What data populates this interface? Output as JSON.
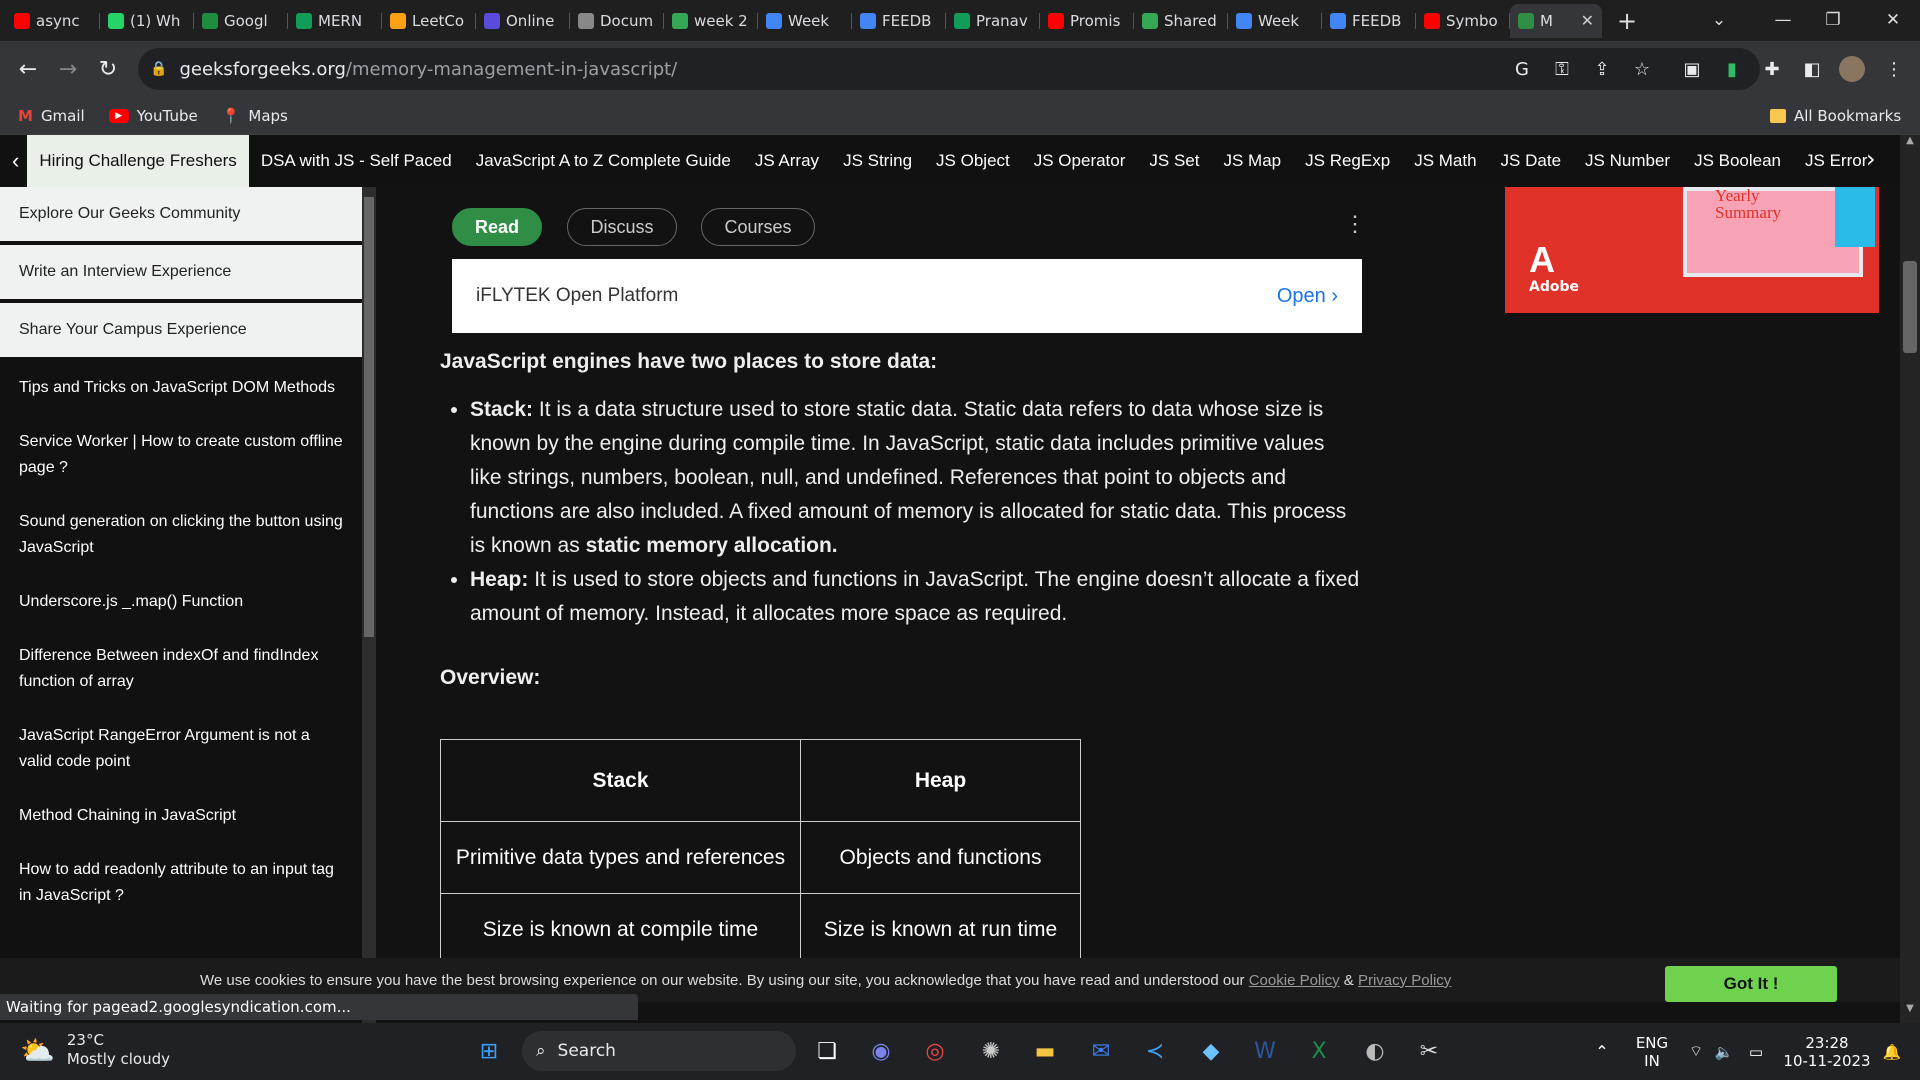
{
  "tabs": [
    {
      "title": "async",
      "icon": "youtube-icon",
      "color": "#ff0000"
    },
    {
      "title": "(1) Wh",
      "icon": "whatsapp-icon",
      "color": "#25d366"
    },
    {
      "title": "Googl",
      "icon": "google-classroom-icon",
      "color": "#1e8e3e"
    },
    {
      "title": "MERN",
      "icon": "sheets-plus-icon",
      "color": "#0f9d58"
    },
    {
      "title": "LeetCo",
      "icon": "leetcode-icon",
      "color": "#ffa116"
    },
    {
      "title": "Online",
      "icon": "online-icon",
      "color": "#5b4bdb"
    },
    {
      "title": "Docum",
      "icon": "document-icon",
      "color": "#888888"
    },
    {
      "title": "week 2",
      "icon": "drive-icon",
      "color": "#34a853"
    },
    {
      "title": "Week",
      "icon": "docs-icon",
      "color": "#4285f4"
    },
    {
      "title": "FEEDB",
      "icon": "docs-icon",
      "color": "#4285f4"
    },
    {
      "title": "Pranav",
      "icon": "sheets-plus-icon",
      "color": "#0f9d58"
    },
    {
      "title": "Promis",
      "icon": "youtube-icon",
      "color": "#ff0000"
    },
    {
      "title": "Shared",
      "icon": "drive-icon",
      "color": "#34a853"
    },
    {
      "title": "Week",
      "icon": "docs-icon",
      "color": "#4285f4"
    },
    {
      "title": "FEEDB",
      "icon": "docs-icon",
      "color": "#4285f4"
    },
    {
      "title": "Symbo",
      "icon": "youtube-icon",
      "color": "#ff0000"
    },
    {
      "title": "M",
      "icon": "gfg-icon",
      "color": "#2f8d46",
      "active": true
    }
  ],
  "url": {
    "host": "geeksforgeeks.org",
    "path": "/memory-management-in-javascript/"
  },
  "bookmarks": [
    {
      "label": "Gmail",
      "icon": "gmail-icon"
    },
    {
      "label": "YouTube",
      "icon": "youtube-icon"
    },
    {
      "label": "Maps",
      "icon": "maps-icon"
    }
  ],
  "all_bookmarks": "All Bookmarks",
  "topnav": [
    "Hiring Challenge Freshers",
    "DSA with JS - Self Paced",
    "JavaScript A to Z Complete Guide",
    "JS Array",
    "JS String",
    "JS Object",
    "JS Operator",
    "JS Set",
    "JS Map",
    "JS RegExp",
    "JS Math",
    "JS Date",
    "JS Number",
    "JS Boolean",
    "JS Error"
  ],
  "sidebar": [
    {
      "label": "Explore Our Geeks Community",
      "light": true
    },
    {
      "label": "Write an Interview Experience",
      "light": true
    },
    {
      "label": "Share Your Campus Experience",
      "light": true
    },
    {
      "label": "Tips and Tricks on JavaScript DOM Methods"
    },
    {
      "label": "Service Worker | How to create custom offline page ?"
    },
    {
      "label": "Sound generation on clicking the button using JavaScript"
    },
    {
      "label": "Underscore.js _.map() Function"
    },
    {
      "label": "Difference Between indexOf and findIndex function of array"
    },
    {
      "label": "JavaScript RangeError Argument is not a valid code point"
    },
    {
      "label": "Method Chaining in JavaScript"
    },
    {
      "label": "How to add readonly attribute to an input tag in JavaScript ?"
    }
  ],
  "pills": {
    "read": "Read",
    "discuss": "Discuss",
    "courses": "Courses"
  },
  "ad": {
    "title": "iFLYTEK Open Platform",
    "open": "Open"
  },
  "article": {
    "heading": "JavaScript engines have two places to store data:",
    "stack_term": "Stack:",
    "stack_text": " It is a data structure used to store static data. Static data refers to data whose size is known by the engine during compile time. In JavaScript, static data includes primitive values like strings, numbers, boolean, null, and undefined. References that point to objects and functions are also included. A fixed amount of memory is allocated for static data. This process is known as ",
    "stack_bold": "static memory allocation.",
    "heap_term": "Heap:",
    "heap_text": " It is used to store objects and functions in JavaScript. The engine doesn’t allocate a fixed amount of memory. Instead, it allocates more space as required.",
    "overview": "Overview:"
  },
  "table": {
    "headers": [
      "Stack",
      "Heap"
    ],
    "rows": [
      [
        "Primitive data types and references",
        "Objects and functions"
      ],
      [
        "Size is known at compile time",
        "Size is known at run time"
      ]
    ]
  },
  "adobe": {
    "brand": "Adobe",
    "text": "Yearly Summary"
  },
  "cookie": {
    "text": "We use cookies to ensure you have the best browsing experience on our website. By using our site, you acknowledge that you have read and understood our ",
    "cookie_link": "Cookie Policy",
    "amp": " & ",
    "privacy_link": "Privacy Policy",
    "button": "Got It !"
  },
  "status": "Waiting for pagead2.googlesyndication.com...",
  "weather": {
    "temp": "23°C",
    "desc": "Mostly cloudy"
  },
  "search_label": "Search",
  "tray": {
    "lang1": "ENG",
    "lang2": "IN",
    "time": "23:28",
    "date": "10-11-2023"
  }
}
